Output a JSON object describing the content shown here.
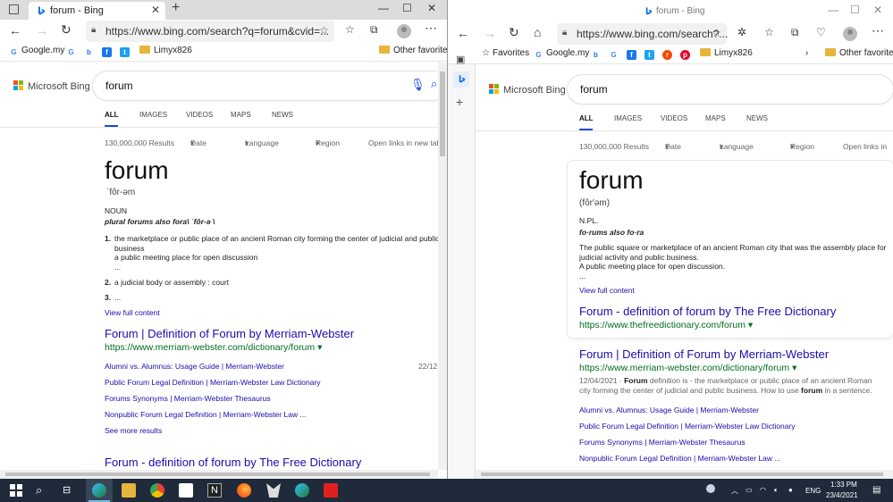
{
  "left": {
    "tab_title": "forum - Bing",
    "url": "https://www.bing.com/search?q=forum&cvid=...",
    "favorites": [
      "Google.my",
      "G",
      "b",
      "f",
      "t",
      "Limyx826"
    ],
    "other_favorites": "Other favorites",
    "logo": "Microsoft Bing",
    "query": "forum",
    "tabs": [
      "ALL",
      "IMAGES",
      "VIDEOS",
      "MAPS",
      "NEWS"
    ],
    "results_count": "130,000,000 Results",
    "filters": [
      "Date",
      "Language",
      "Region"
    ],
    "open_links": "Open links in new tab",
    "word": "forum",
    "pronunciation": "ˈfôr-əm",
    "pos": "NOUN",
    "plural_prefix": "plural",
    "plural_rest": "forums also fora\\ ˈfôr-ə \\",
    "defs": [
      {
        "num": "1.",
        "text": "the marketplace or public place of an ancient Roman city forming the center of judicial and public business",
        "sub": "a public meeting place for open discussion",
        "more": "..."
      },
      {
        "num": "2.",
        "text": "a judicial body or assembly : court"
      },
      {
        "num": "3.",
        "text": "..."
      }
    ],
    "view_full": "View full content",
    "result1_title": "Forum | Definition of Forum by Merriam-Webster",
    "result1_url": "https://www.merriam-webster.com/dictionary/forum ▾",
    "result1_date": "22/12",
    "sublinks": [
      "Alumni vs. Alumnus: Usage Guide | Merriam-Webster",
      "Public Forum Legal Definition | Merriam-Webster Law Dictionary",
      "Forums Synonyms | Merriam-Webster Thesaurus",
      "Nonpublic Forum Legal Definition | Merriam-Webster Law ..."
    ],
    "see_more": "See more results",
    "result2_title": "Forum - definition of forum by The Free Dictionary"
  },
  "right": {
    "tab_title": "forum - Bing",
    "url": "https://www.bing.com/search?...",
    "favorites_label": "Favorites",
    "favorites": [
      "Google.my",
      "b",
      "G",
      "f",
      "t",
      "r",
      "p",
      "Limyx826"
    ],
    "other_favorites": "Other favorites",
    "logo": "Microsoft Bing",
    "query": "forum",
    "tabs": [
      "ALL",
      "IMAGES",
      "VIDEOS",
      "MAPS",
      "NEWS"
    ],
    "results_count": "130,000,000 Results",
    "filters": [
      "Date",
      "Language",
      "Region"
    ],
    "open_links": "Open links in",
    "word": "forum",
    "pronunciation": "(fôr′əm)",
    "pos": "N.PL.",
    "plural": "fo·rums also fo·ra",
    "def1": "The public square or marketplace of an ancient Roman city that was the assembly place for judicial activity and public business.",
    "def2": "A public meeting place for open discussion.",
    "def_more": "...",
    "view_full": "View full content",
    "card_title": "Forum - definition of forum by The Free Dictionary",
    "card_url": "https://www.thefreedictionary.com/forum ▾",
    "result1_title": "Forum | Definition of Forum by Merriam-Webster",
    "result1_url": "https://www.merriam-webster.com/dictionary/forum ▾",
    "snippet_date": "12/04/2021 · ",
    "snippet_bold1": "Forum",
    "snippet_mid": " definition is - the marketplace or public place of an ancient Roman city forming the center of judicial and public business. How to use ",
    "snippet_bold2": "forum",
    "snippet_end": " in a sentence.",
    "sublinks": [
      "Alumni vs. Alumnus: Usage Guide | Merriam-Webster",
      "Public Forum Legal Definition | Merriam-Webster Law Dictionary",
      "Forums Synonyms | Merriam-Webster Thesaurus",
      "Nonpublic Forum Legal Definition | Merriam-Webster Law ..."
    ]
  },
  "taskbar": {
    "time": "1:33 PM",
    "date": "23/4/2021",
    "lang": "ENG"
  },
  "colors": {
    "link": "#1a0dab",
    "url_green": "#006d21",
    "bing_blue": "#174ae4",
    "taskbar": "#1f2a3a"
  }
}
